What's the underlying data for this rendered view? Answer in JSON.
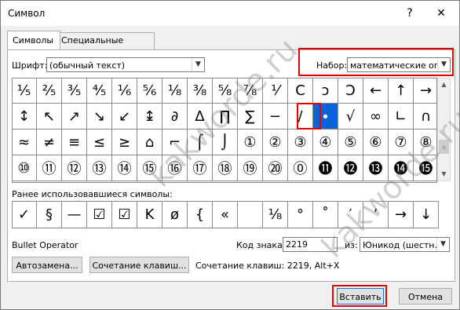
{
  "window": {
    "title": "Символ",
    "help_label": "?",
    "close_label": "✕"
  },
  "tabs": [
    {
      "label": "Символы"
    },
    {
      "label": "Специальные знаки"
    }
  ],
  "font": {
    "label": "Шрифт:",
    "value": "(обычный текст)"
  },
  "subset": {
    "label": "Набор:",
    "value": "математические опер"
  },
  "symbol_rows": [
    [
      "⅕",
      "⅖",
      "⅗",
      "⅘",
      "⅙",
      "⅚",
      "⅛",
      "⅜",
      "⅝",
      "⅞",
      "⅟",
      "Ⅽ",
      "ↄ",
      "Ↄ",
      "←",
      "↑",
      "→",
      "↓"
    ],
    [
      "↕",
      "↖",
      "↗",
      "↘",
      "↙",
      "↨",
      "∂",
      "∆",
      "∏",
      "∑",
      "−",
      "∕",
      "∙",
      "√",
      "∞",
      "∟",
      "∩",
      "∫"
    ],
    [
      "≈",
      "≠",
      "≡",
      "≤",
      "≥",
      "⌂",
      "⌐",
      "⌠",
      "⌡",
      "①",
      "②",
      "③",
      "④",
      "⑤",
      "⑥",
      "⑦",
      "⑧",
      "⑨"
    ],
    [
      "⑩",
      "⑪",
      "⑫",
      "⑬",
      "⑭",
      "⑮",
      "⑯",
      "⑰",
      "⑱",
      "⑲",
      "⑳",
      "⓪",
      "⓫",
      "⓬",
      "⓭",
      "⓮",
      "⓯",
      "⓰"
    ]
  ],
  "recent": {
    "label": "Ранее использовавшиеся символы:",
    "symbols": [
      "✓",
      "§",
      "—",
      "☑",
      "☑",
      "K",
      "ø",
      "{",
      "«",
      "",
      "⅛",
      "°",
      "˚",
      "′",
      "’",
      "→",
      "↓"
    ]
  },
  "char_name": "Bullet Operator",
  "char_code": {
    "label": "Код знака:",
    "value": "2219"
  },
  "from": {
    "label": "из:",
    "value": "Юникод (шестн.)"
  },
  "buttons": {
    "autocorrect": "Автозамена...",
    "shortcut": "Сочетание клавиш...",
    "insert": "Вставить",
    "cancel": "Отмена"
  },
  "shortcut_text": "Сочетание клавиш: 2219, Alt+X",
  "watermark": "kakworde.ru",
  "colors": {
    "selection": "#0a64d6",
    "highlight": "#e00000"
  }
}
